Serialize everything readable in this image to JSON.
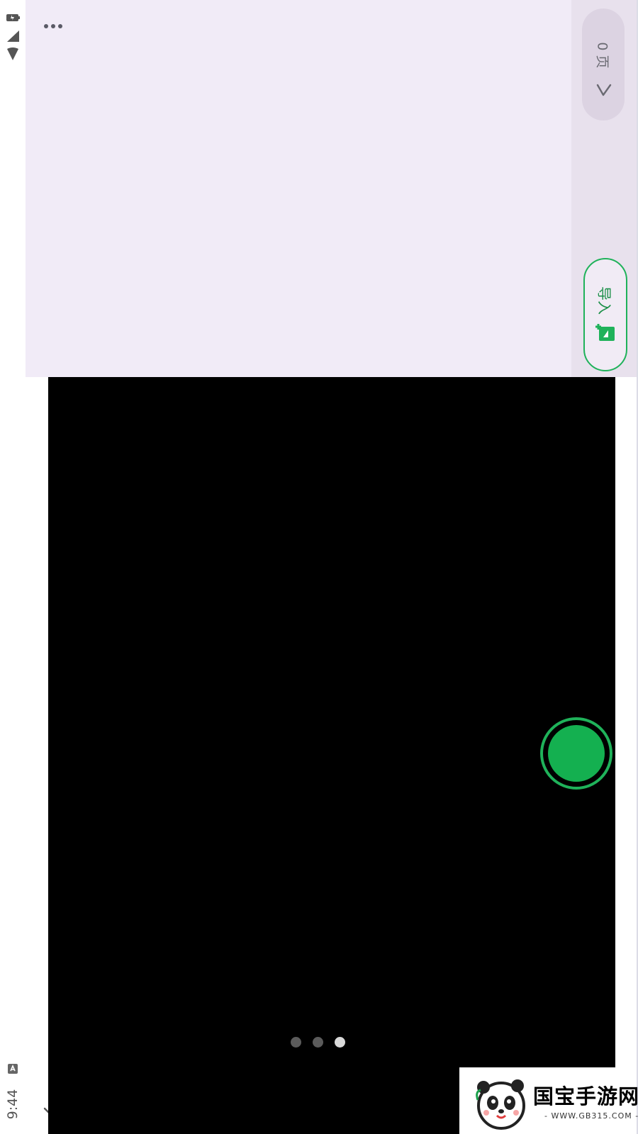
{
  "status_bar": {
    "time": "9:44",
    "icons": [
      "battery-icon",
      "signal-icon",
      "wifi-icon",
      "notification-icon"
    ]
  },
  "top_bar": {
    "more_icon": "more-horizontal-icon"
  },
  "side_controls": {
    "pages_label": "0 页",
    "pages_icon": "chevron-icon",
    "import_label": "导入",
    "import_icon": "add-image-icon"
  },
  "camera": {
    "shutter_icon": "shutter-button",
    "page_indicator": {
      "count": 3,
      "active_index": 2
    }
  },
  "navigation": {
    "down_icon": "arrow-down-icon"
  },
  "watermark": {
    "title": "国宝手游网",
    "url": "- WWW.GB315.COM -"
  },
  "colors": {
    "accent_green": "#1fb25a",
    "panel_lavender": "#f1ebf7",
    "viewfinder_black": "#000000"
  }
}
